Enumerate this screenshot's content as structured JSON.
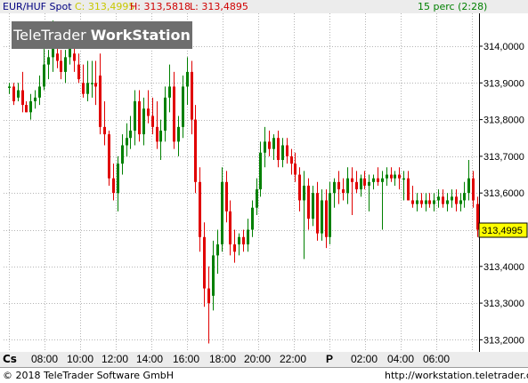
{
  "header": {
    "symbol": "EUR/HUF Spot",
    "close_label": "C: 313,4995",
    "high_label": "H: 313,5818",
    "low_label": "L: 313,4895",
    "interval": "15 perc (2:28)"
  },
  "watermark": {
    "text_light": "TeleTrader",
    "text_bold": "WorkStation"
  },
  "corner_label": "Cs",
  "current_price_label": "313,4995",
  "footer": {
    "copyright": "© 2018 TeleTrader Software GmbH",
    "url": "http://workstation.teletrader.com/"
  },
  "colors": {
    "up": "#008000",
    "down": "#e00000",
    "grid": "#b4b4b4",
    "price_tag": "#ffff00",
    "header_close": "#c8c800",
    "header_high_low": "#d00000",
    "header_symbol": "#000080",
    "header_interval": "#008000",
    "watermark_bg": "#6e6e6e"
  },
  "chart_data": {
    "type": "candlestick",
    "x_tick_labels": [
      "08:00",
      "10:00",
      "12:00",
      "14:00",
      "16:00",
      "18:00",
      "20:00",
      "22:00",
      "P",
      "02:00",
      "04:00",
      "06:00"
    ],
    "y_tick_labels": [
      "314,0000",
      "313,9000",
      "313,8000",
      "313,7000",
      "313,6000",
      "313,4000",
      "313,3000",
      "313,2000"
    ],
    "ylim": [
      313.18,
      314.1
    ],
    "candles": [
      [
        313.89,
        313.9,
        313.87,
        313.89
      ],
      [
        313.89,
        313.9,
        313.84,
        313.85
      ],
      [
        313.86,
        313.9,
        313.85,
        313.88
      ],
      [
        313.88,
        313.93,
        313.82,
        313.84
      ],
      [
        313.84,
        313.85,
        313.82,
        313.82
      ],
      [
        313.82,
        313.87,
        313.8,
        313.85
      ],
      [
        313.85,
        313.88,
        313.83,
        313.86
      ],
      [
        313.86,
        313.92,
        313.84,
        313.89
      ],
      [
        313.89,
        314.06,
        313.88,
        313.95
      ],
      [
        313.95,
        313.99,
        313.91,
        313.97
      ],
      [
        313.97,
        314.07,
        313.93,
        314.0
      ],
      [
        313.98,
        314.04,
        313.94,
        313.96
      ],
      [
        313.96,
        313.99,
        313.91,
        313.93
      ],
      [
        313.93,
        313.99,
        313.9,
        313.97
      ],
      [
        313.97,
        314.02,
        313.95,
        314.0
      ],
      [
        313.98,
        314.05,
        313.93,
        313.96
      ],
      [
        313.95,
        313.98,
        313.9,
        313.91
      ],
      [
        313.9,
        313.95,
        313.86,
        313.87
      ],
      [
        313.87,
        313.96,
        313.85,
        313.9
      ],
      [
        313.9,
        313.96,
        313.86,
        313.9
      ],
      [
        313.9,
        313.96,
        313.84,
        313.89
      ],
      [
        313.92,
        313.98,
        313.76,
        313.78
      ],
      [
        313.78,
        313.85,
        313.73,
        313.76
      ],
      [
        313.76,
        313.77,
        313.62,
        313.64
      ],
      [
        313.64,
        313.68,
        313.58,
        313.6
      ],
      [
        313.6,
        313.7,
        313.55,
        313.68
      ],
      [
        313.68,
        313.76,
        313.65,
        313.73
      ],
      [
        313.73,
        313.79,
        313.7,
        313.75
      ],
      [
        313.75,
        313.81,
        313.72,
        313.77
      ],
      [
        313.77,
        313.88,
        313.73,
        313.85
      ],
      [
        313.85,
        313.88,
        313.74,
        313.76
      ],
      [
        313.76,
        313.86,
        313.73,
        313.83
      ],
      [
        313.83,
        313.88,
        313.79,
        313.81
      ],
      [
        313.81,
        313.86,
        313.76,
        313.78
      ],
      [
        313.78,
        313.85,
        313.72,
        313.74
      ],
      [
        313.74,
        313.8,
        313.69,
        313.77
      ],
      [
        313.77,
        313.89,
        313.74,
        313.86
      ],
      [
        313.86,
        313.95,
        313.82,
        313.89
      ],
      [
        313.89,
        313.93,
        313.72,
        313.74
      ],
      [
        313.74,
        313.81,
        313.7,
        313.78
      ],
      [
        313.78,
        313.92,
        313.75,
        313.89
      ],
      [
        313.89,
        313.97,
        313.84,
        313.93
      ],
      [
        313.93,
        313.96,
        313.76,
        313.8
      ],
      [
        313.8,
        313.84,
        313.6,
        313.63
      ],
      [
        313.63,
        313.67,
        313.44,
        313.48
      ],
      [
        313.48,
        313.52,
        313.29,
        313.34
      ],
      [
        313.34,
        313.4,
        313.19,
        313.3
      ],
      [
        313.32,
        313.47,
        313.28,
        313.43
      ],
      [
        313.43,
        313.5,
        313.38,
        313.46
      ],
      [
        313.46,
        313.67,
        313.44,
        313.63
      ],
      [
        313.63,
        313.66,
        313.52,
        313.55
      ],
      [
        313.55,
        313.58,
        313.43,
        313.46
      ],
      [
        313.46,
        313.5,
        313.41,
        313.44
      ],
      [
        313.46,
        313.49,
        313.43,
        313.48
      ],
      [
        313.48,
        313.5,
        313.44,
        313.46
      ],
      [
        313.46,
        313.53,
        313.44,
        313.5
      ],
      [
        313.5,
        313.58,
        313.48,
        313.56
      ],
      [
        313.56,
        313.64,
        313.54,
        313.61
      ],
      [
        313.61,
        313.74,
        313.59,
        313.71
      ],
      [
        313.71,
        313.78,
        313.67,
        313.74
      ],
      [
        313.74,
        313.77,
        313.7,
        313.72
      ],
      [
        313.72,
        313.76,
        313.69,
        313.75
      ],
      [
        313.75,
        313.77,
        313.67,
        313.69
      ],
      [
        313.69,
        313.75,
        313.67,
        313.73
      ],
      [
        313.73,
        313.75,
        313.68,
        313.7
      ],
      [
        313.7,
        313.72,
        313.65,
        313.68
      ],
      [
        313.68,
        313.71,
        313.63,
        313.65
      ],
      [
        313.65,
        313.67,
        313.55,
        313.58
      ],
      [
        313.58,
        313.66,
        313.42,
        313.62
      ],
      [
        313.62,
        313.64,
        313.5,
        313.53
      ],
      [
        313.53,
        313.62,
        313.51,
        313.6
      ],
      [
        313.6,
        313.63,
        313.47,
        313.49
      ],
      [
        313.49,
        313.61,
        313.47,
        313.58
      ],
      [
        313.58,
        313.61,
        313.45,
        313.48
      ],
      [
        313.48,
        313.63,
        313.46,
        313.6
      ],
      [
        313.6,
        313.64,
        313.56,
        313.63
      ],
      [
        313.63,
        313.66,
        313.57,
        313.61
      ],
      [
        313.61,
        313.64,
        313.58,
        313.6
      ],
      [
        313.6,
        313.67,
        313.57,
        313.64
      ],
      [
        313.64,
        313.67,
        313.54,
        313.63
      ],
      [
        313.63,
        313.66,
        313.6,
        313.61
      ],
      [
        313.61,
        313.65,
        313.59,
        313.64
      ],
      [
        313.64,
        313.66,
        313.61,
        313.62
      ],
      [
        313.62,
        313.65,
        313.55,
        313.63
      ],
      [
        313.63,
        313.65,
        313.61,
        313.64
      ],
      [
        313.64,
        313.67,
        313.62,
        313.63
      ],
      [
        313.63,
        313.66,
        313.5,
        313.64
      ],
      [
        313.64,
        313.67,
        313.62,
        313.65
      ],
      [
        313.65,
        313.67,
        313.63,
        313.64
      ],
      [
        313.64,
        313.66,
        313.62,
        313.65
      ],
      [
        313.65,
        313.67,
        313.61,
        313.64
      ],
      [
        313.64,
        313.66,
        313.58,
        313.64
      ],
      [
        313.64,
        313.66,
        313.58,
        313.58
      ],
      [
        313.58,
        313.62,
        313.56,
        313.57
      ],
      [
        313.57,
        313.6,
        313.55,
        313.58
      ],
      [
        313.58,
        313.6,
        313.56,
        313.57
      ],
      [
        313.57,
        313.6,
        313.55,
        313.58
      ],
      [
        313.58,
        313.6,
        313.56,
        313.57
      ],
      [
        313.57,
        313.6,
        313.55,
        313.58
      ],
      [
        313.58,
        313.61,
        313.56,
        313.59
      ],
      [
        313.59,
        313.61,
        313.56,
        313.57
      ],
      [
        313.57,
        313.6,
        313.55,
        313.58
      ],
      [
        313.58,
        313.61,
        313.56,
        313.59
      ],
      [
        313.59,
        313.61,
        313.55,
        313.57
      ],
      [
        313.57,
        313.6,
        313.55,
        313.58
      ],
      [
        313.58,
        313.63,
        313.56,
        313.6
      ],
      [
        313.6,
        313.69,
        313.58,
        313.64
      ],
      [
        313.64,
        313.66,
        313.56,
        313.58
      ],
      [
        313.57,
        313.59,
        313.48,
        313.5
      ]
    ]
  }
}
